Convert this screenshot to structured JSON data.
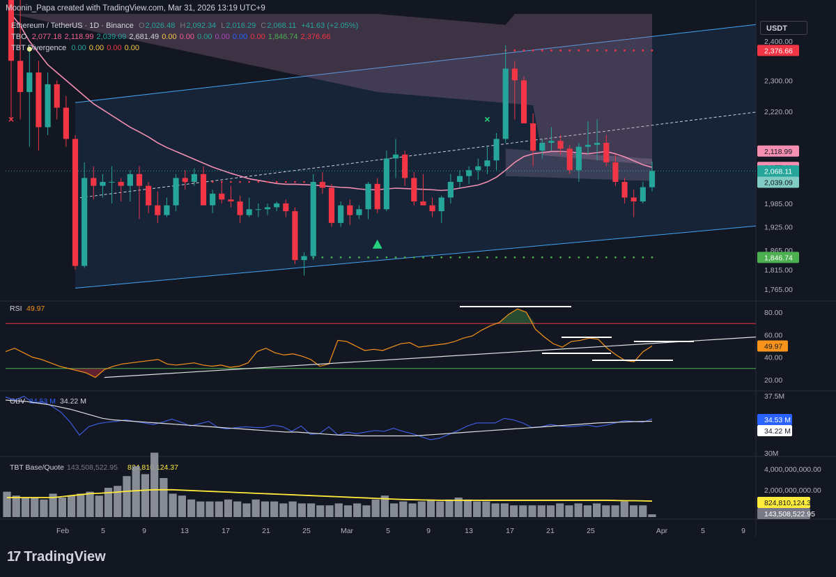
{
  "header": {
    "attribution": "Moonin_Papa created with TradingView.com, Mar 31, 2026 13:19 UTC+9",
    "symbol": "Ethereum / TetherUS · 1D · Binance",
    "ohlc": {
      "o_label": "O",
      "o": "2,026.48",
      "h_label": "H",
      "h": "2,092.34",
      "l_label": "L",
      "l": "2,016.29",
      "c_label": "C",
      "c": "2,068.11",
      "change": "+41.63 (+2.05%)"
    },
    "tbo": {
      "label": "TBO",
      "values": [
        "2,077.18",
        "2,118.99",
        "2,039.09",
        "2,681.49",
        "0.00",
        "0.00",
        "0.00",
        "0.00",
        "0.00",
        "0.00",
        "1,846.74",
        "2,376.66"
      ],
      "colors": [
        "#f06292",
        "#f06292",
        "#26a69a",
        "#d1d4dc",
        "#f7c948",
        "#f06292",
        "#26a69a",
        "#ab47bc",
        "#2962ff",
        "#f23645",
        "#4caf50",
        "#f23645"
      ]
    },
    "divergence": {
      "label": "TBT Divergence",
      "values": [
        "0.00",
        "0.00",
        "0.00",
        "0.00"
      ],
      "colors": [
        "#26a69a",
        "#f7c948",
        "#f23645",
        "#f7c948"
      ]
    },
    "currency_button": "USDT"
  },
  "price_axis": {
    "ticks": [
      "2,400.00",
      "2,300.00",
      "2,220.00",
      "1,985.00",
      "1,925.00",
      "1,865.00",
      "1,815.00",
      "1,765.00"
    ],
    "tick_values": [
      2400,
      2300,
      2220,
      1985,
      1925,
      1865,
      1815,
      1765
    ],
    "labels": [
      {
        "text": "2,376.66",
        "value": 2376.66,
        "bg": "#f23645",
        "fg": "#ffffff"
      },
      {
        "text": "2,118.99",
        "value": 2118.99,
        "bg": "#f48fb1",
        "fg": "#131722"
      },
      {
        "text": "2,077.18",
        "value": 2077.18,
        "bg": "#f48fb1",
        "fg": "#131722"
      },
      {
        "text": "2,068.11",
        "value": 2068.11,
        "bg": "#26a69a",
        "fg": "#ffffff"
      },
      {
        "text": "19:40:07",
        "value": 2045.0,
        "bg": "#26a69a",
        "fg": "#ffffff"
      },
      {
        "text": "2,039.09",
        "value": 2039.09,
        "bg": "#80cbc4",
        "fg": "#131722"
      },
      {
        "text": "1,846.74",
        "value": 1846.74,
        "bg": "#4caf50",
        "fg": "#ffffff"
      }
    ]
  },
  "chart_data": [
    {
      "type": "candlestick",
      "title": "Ethereum / TetherUS · 1D · Binance",
      "ylim": [
        1735,
        2470
      ],
      "x_ticks": [
        "Feb",
        "5",
        "9",
        "13",
        "17",
        "21",
        "25",
        "Mar",
        "5",
        "9",
        "13",
        "17",
        "21",
        "25",
        "Apr",
        "5",
        "9"
      ],
      "candles": [
        [
          2540,
          2700,
          2200,
          2350
        ],
        [
          2350,
          2520,
          2200,
          2270
        ],
        [
          2270,
          2380,
          2130,
          2320
        ],
        [
          2320,
          2350,
          2120,
          2180
        ],
        [
          2180,
          2320,
          2160,
          2290
        ],
        [
          2290,
          2300,
          2200,
          2230
        ],
        [
          2230,
          2260,
          2130,
          2150
        ],
        [
          2150,
          2160,
          1815,
          1825
        ],
        [
          1825,
          2090,
          1820,
          2050
        ],
        [
          2050,
          2080,
          1995,
          2030
        ],
        [
          2030,
          2060,
          2000,
          2040
        ],
        [
          2040,
          2080,
          1985,
          2040
        ],
        [
          2040,
          2050,
          1990,
          2030
        ],
        [
          2030,
          2070,
          1990,
          2060
        ],
        [
          2060,
          2080,
          1945,
          2030
        ],
        [
          2030,
          2040,
          1960,
          1980
        ],
        [
          1980,
          2015,
          1935,
          1955
        ],
        [
          1955,
          2000,
          1950,
          1980
        ],
        [
          1980,
          2060,
          1965,
          2050
        ],
        [
          2050,
          2070,
          2020,
          2040
        ],
        [
          2040,
          2075,
          2030,
          2060
        ],
        [
          2060,
          2080,
          1985,
          1980
        ],
        [
          1980,
          2020,
          1960,
          2010
        ],
        [
          2010,
          2040,
          1985,
          1995
        ],
        [
          1995,
          2030,
          1975,
          1990
        ],
        [
          1990,
          2005,
          1935,
          1955
        ],
        [
          1955,
          2000,
          1950,
          1970
        ],
        [
          1970,
          1985,
          1950,
          1970
        ],
        [
          1970,
          1985,
          1955,
          1975
        ],
        [
          1975,
          1990,
          1965,
          1985
        ],
        [
          1985,
          1995,
          1950,
          1965
        ],
        [
          1965,
          1975,
          1830,
          1840
        ],
        [
          1840,
          1860,
          1800,
          1850
        ],
        [
          1850,
          2060,
          1840,
          2040
        ],
        [
          2040,
          2065,
          2010,
          2025
        ],
        [
          2025,
          2035,
          1925,
          1935
        ],
        [
          1935,
          1990,
          1925,
          1980
        ],
        [
          1980,
          1995,
          1930,
          1955
        ],
        [
          1955,
          1980,
          1945,
          1970
        ],
        [
          1970,
          2040,
          1945,
          2035
        ],
        [
          2035,
          2050,
          1960,
          1970
        ],
        [
          1970,
          2120,
          1965,
          2100
        ],
        [
          2100,
          2150,
          2050,
          2110
        ],
        [
          2110,
          2120,
          2030,
          2050
        ],
        [
          2050,
          2065,
          1980,
          1990
        ],
        [
          1990,
          2060,
          1985,
          1980
        ],
        [
          1980,
          2000,
          1950,
          1965
        ],
        [
          1965,
          2005,
          1935,
          2000
        ],
        [
          2000,
          2060,
          1985,
          2040
        ],
        [
          2040,
          2070,
          2025,
          2055
        ],
        [
          2055,
          2080,
          2035,
          2070
        ],
        [
          2070,
          2100,
          2045,
          2080
        ],
        [
          2080,
          2130,
          2060,
          2095
        ],
        [
          2095,
          2165,
          2070,
          2150
        ],
        [
          2150,
          2390,
          2140,
          2330
        ],
        [
          2330,
          2350,
          2200,
          2300
        ],
        [
          2300,
          2310,
          2190,
          2190
        ],
        [
          2190,
          2215,
          2080,
          2120
        ],
        [
          2120,
          2150,
          2100,
          2140
        ],
        [
          2140,
          2180,
          2120,
          2145
        ],
        [
          2145,
          2160,
          2110,
          2125
        ],
        [
          2125,
          2135,
          2060,
          2070
        ],
        [
          2070,
          2140,
          2040,
          2130
        ],
        [
          2130,
          2195,
          2110,
          2135
        ],
        [
          2135,
          2200,
          2095,
          2140
        ],
        [
          2140,
          2160,
          2080,
          2090
        ],
        [
          2090,
          2110,
          2030,
          2040
        ],
        [
          2040,
          2050,
          1985,
          2000
        ],
        [
          2000,
          2020,
          1950,
          1990
        ],
        [
          1990,
          2040,
          1985,
          2026.48
        ],
        [
          2026.48,
          2092.34,
          2016.29,
          2068.11
        ]
      ],
      "overlay_line": "TBO",
      "markers": [
        {
          "type": "cross",
          "color": "#f23645",
          "at_candle": 0,
          "value": 2200
        },
        {
          "type": "circle",
          "color": "#f7f77a",
          "at_candle": 2,
          "value": 2380
        },
        {
          "type": "triangle-up",
          "color": "#26d07c",
          "at_candle": 40,
          "value": 1880
        },
        {
          "type": "cross",
          "color": "#26d07c",
          "at_candle": 52,
          "value": 2200
        }
      ],
      "levels": [
        {
          "value": 2376.66,
          "color": "#f23645"
        },
        {
          "value": 1846.74,
          "color": "#4caf50"
        }
      ]
    },
    {
      "type": "line",
      "title": "RSI",
      "value_label": "49.97",
      "ylim": [
        10,
        90
      ],
      "ticks": [
        "80.00",
        "60.00",
        "40.00",
        "20.00"
      ],
      "tick_values": [
        80,
        60,
        40,
        20
      ],
      "bands": [
        70,
        30
      ],
      "series": [
        {
          "color": "#f7931a",
          "values": [
            45,
            48,
            44,
            40,
            38,
            35,
            32,
            30,
            28,
            26,
            22,
            29,
            32,
            34,
            35,
            36,
            37,
            38,
            34,
            33,
            34,
            35,
            33,
            32,
            33,
            31,
            32,
            35,
            45,
            48,
            44,
            42,
            43,
            41,
            38,
            32,
            34,
            55,
            54,
            50,
            46,
            47,
            46,
            49,
            52,
            53,
            49,
            50,
            51,
            52,
            54,
            57,
            59,
            64,
            68,
            71,
            78,
            83,
            80,
            65,
            58,
            52,
            49,
            54,
            55,
            57,
            56,
            48,
            42,
            37,
            36,
            45,
            49.97
          ]
        }
      ],
      "label": {
        "text": "49.97",
        "value": 49.97,
        "bg": "#f7931a"
      }
    },
    {
      "type": "line",
      "title": "OBV",
      "values_label": [
        "34.53 M",
        "34.22 M"
      ],
      "ticks": [
        "37.5M",
        "30M"
      ],
      "series": [
        {
          "color": "#3b5bdb",
          "values": [
            37.4,
            37.0,
            37.5,
            36.6,
            36.8,
            36.2,
            35.4,
            34.1,
            32.4,
            33.5,
            33.9,
            34.1,
            34.2,
            34.4,
            34.2,
            34.0,
            33.8,
            34.1,
            34.5,
            34.1,
            33.6,
            33.9,
            34.2,
            33.4,
            33.2,
            33.4,
            33.5,
            33.4,
            33.4,
            33.7,
            33.5,
            32.9,
            33.6,
            32.5,
            32.6,
            33.5,
            32.4,
            32.8,
            32.6,
            32.8,
            33.0,
            32.9,
            33.3,
            32.9,
            32.6,
            32.2,
            31.8,
            32.0,
            32.5,
            33.0,
            33.6,
            34.0,
            34.0,
            34.0,
            34.6,
            34.4,
            34.0,
            33.4,
            33.5,
            33.8,
            33.6,
            33.5,
            33.6,
            33.7,
            33.5,
            33.7,
            34.0,
            34.3,
            34.2,
            34.1,
            34.53
          ]
        },
        {
          "color": "#e0e0e0",
          "values": [
            37.0,
            36.9,
            36.8,
            36.6,
            36.4,
            36.1,
            35.8,
            35.4,
            35.0,
            34.6,
            34.4,
            34.3,
            34.2,
            34.1,
            34.0,
            33.9,
            33.8,
            33.7,
            33.6,
            33.5,
            33.4,
            33.3,
            33.2,
            33.1,
            33.0,
            32.9,
            32.8,
            32.8,
            32.7,
            32.6,
            32.5,
            32.4,
            32.4,
            32.3,
            32.3,
            32.3,
            32.3,
            32.3,
            32.3,
            32.4,
            32.5,
            32.6,
            32.7,
            32.8,
            32.9,
            33.0,
            33.1,
            33.2,
            33.3,
            33.4,
            33.5,
            33.6,
            33.7,
            33.8,
            33.9,
            34.0,
            34.05,
            34.1,
            34.15,
            34.2,
            34.22
          ]
        }
      ],
      "labels": [
        {
          "text": "34.53 M",
          "bg": "#2962ff",
          "fg": "#ffffff"
        },
        {
          "text": "34.22 M",
          "bg": "#ffffff",
          "fg": "#131722"
        }
      ]
    },
    {
      "type": "bar",
      "title": "TBT Base/Quote",
      "values_label": [
        "143,508,522.95",
        "824,810,124.37"
      ],
      "ticks": [
        "4,000,000,000.00",
        "2,000,000,000.00"
      ],
      "values": [
        1.3,
        1.1,
        1.0,
        1.0,
        0.9,
        1.2,
        1.0,
        1.1,
        1.2,
        1.3,
        1.1,
        1.5,
        1.6,
        2.1,
        2.6,
        2.2,
        3.3,
        2.0,
        1.2,
        1.1,
        0.9,
        0.8,
        0.8,
        0.8,
        0.9,
        0.8,
        0.7,
        0.9,
        0.8,
        0.8,
        0.7,
        0.8,
        0.7,
        0.7,
        0.6,
        0.6,
        0.7,
        0.6,
        0.7,
        0.6,
        0.9,
        1.1,
        0.7,
        0.8,
        0.7,
        0.8,
        0.9,
        0.8,
        0.9,
        1.0,
        0.9,
        0.8,
        0.8,
        0.7,
        0.7,
        0.6,
        0.6,
        0.6,
        0.6,
        0.6,
        0.7,
        0.6,
        0.7,
        0.6,
        0.7,
        0.6,
        0.6,
        0.8,
        0.6,
        0.6,
        0.14
      ],
      "ma": [
        1.0,
        1.0,
        1.0,
        1.0,
        1.0,
        1.0,
        1.05,
        1.1,
        1.15,
        1.2,
        1.22,
        1.25,
        1.28,
        1.32,
        1.35,
        1.38,
        1.4,
        1.4,
        1.4,
        1.38,
        1.36,
        1.34,
        1.32,
        1.3,
        1.28,
        1.26,
        1.24,
        1.22,
        1.2,
        1.18,
        1.16,
        1.14,
        1.12,
        1.1,
        1.08,
        1.06,
        1.04,
        1.02,
        1.0,
        0.98,
        0.96,
        0.94,
        0.92,
        0.9,
        0.89,
        0.88,
        0.87,
        0.86,
        0.86,
        0.86,
        0.86,
        0.86,
        0.86,
        0.86,
        0.86,
        0.86,
        0.86,
        0.86,
        0.86,
        0.86,
        0.86,
        0.86,
        0.86,
        0.86,
        0.86,
        0.86,
        0.85,
        0.84,
        0.84,
        0.83,
        0.82
      ],
      "labels": [
        {
          "text": "824,810,124.37",
          "bg": "#ffeb3b",
          "fg": "#131722"
        },
        {
          "text": "143,508,522.95",
          "bg": "#787b86",
          "fg": "#ffffff"
        }
      ]
    }
  ],
  "brand": {
    "mark": "17",
    "name": "TradingView"
  }
}
